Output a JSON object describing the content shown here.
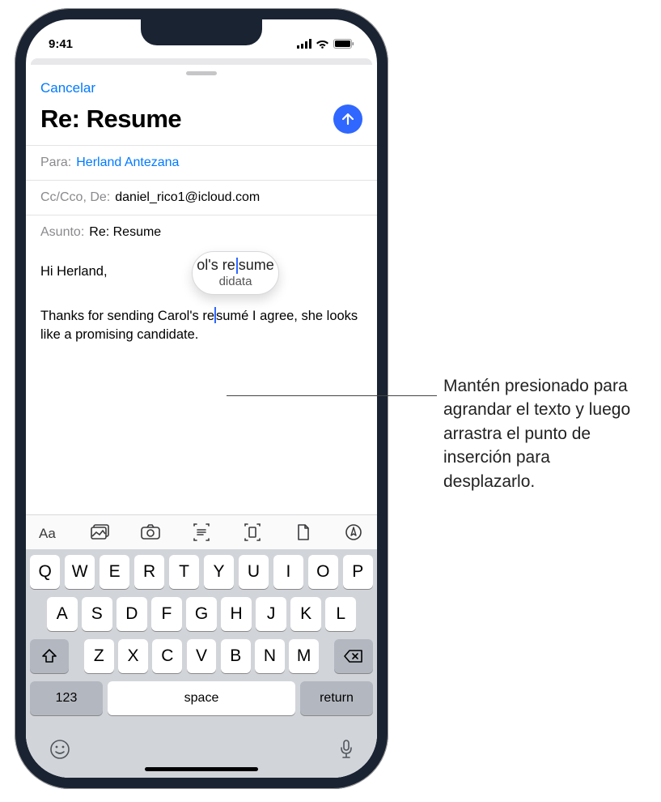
{
  "status": {
    "time": "9:41"
  },
  "compose": {
    "cancel": "Cancelar",
    "subject_title": "Re: Resume",
    "to_label": "Para:",
    "to_value": "Herland Antezana",
    "cc_label": "Cc/Cco, De:",
    "cc_value": "daniel_rico1@icloud.com",
    "subject_label": "Asunto:",
    "subject_value": "Re: Resume",
    "body_line1": "Hi Herland,",
    "body_line2a": "Thanks for sending Carol's re",
    "body_line2b": "sumé I agree, she looks like a promising candidate.",
    "loupe_top_a": "ol's re",
    "loupe_top_b": "sume",
    "loupe_bottom": "didata"
  },
  "keyboard": {
    "row1": [
      "Q",
      "W",
      "E",
      "R",
      "T",
      "Y",
      "U",
      "I",
      "O",
      "P"
    ],
    "row2": [
      "A",
      "S",
      "D",
      "F",
      "G",
      "H",
      "J",
      "K",
      "L"
    ],
    "row3": [
      "Z",
      "X",
      "C",
      "V",
      "B",
      "N",
      "M"
    ],
    "k123": "123",
    "space": "space",
    "ret": "return"
  },
  "callout": "Mantén presionado para agrandar el texto y luego arrastra el punto de inserción para desplazarlo."
}
